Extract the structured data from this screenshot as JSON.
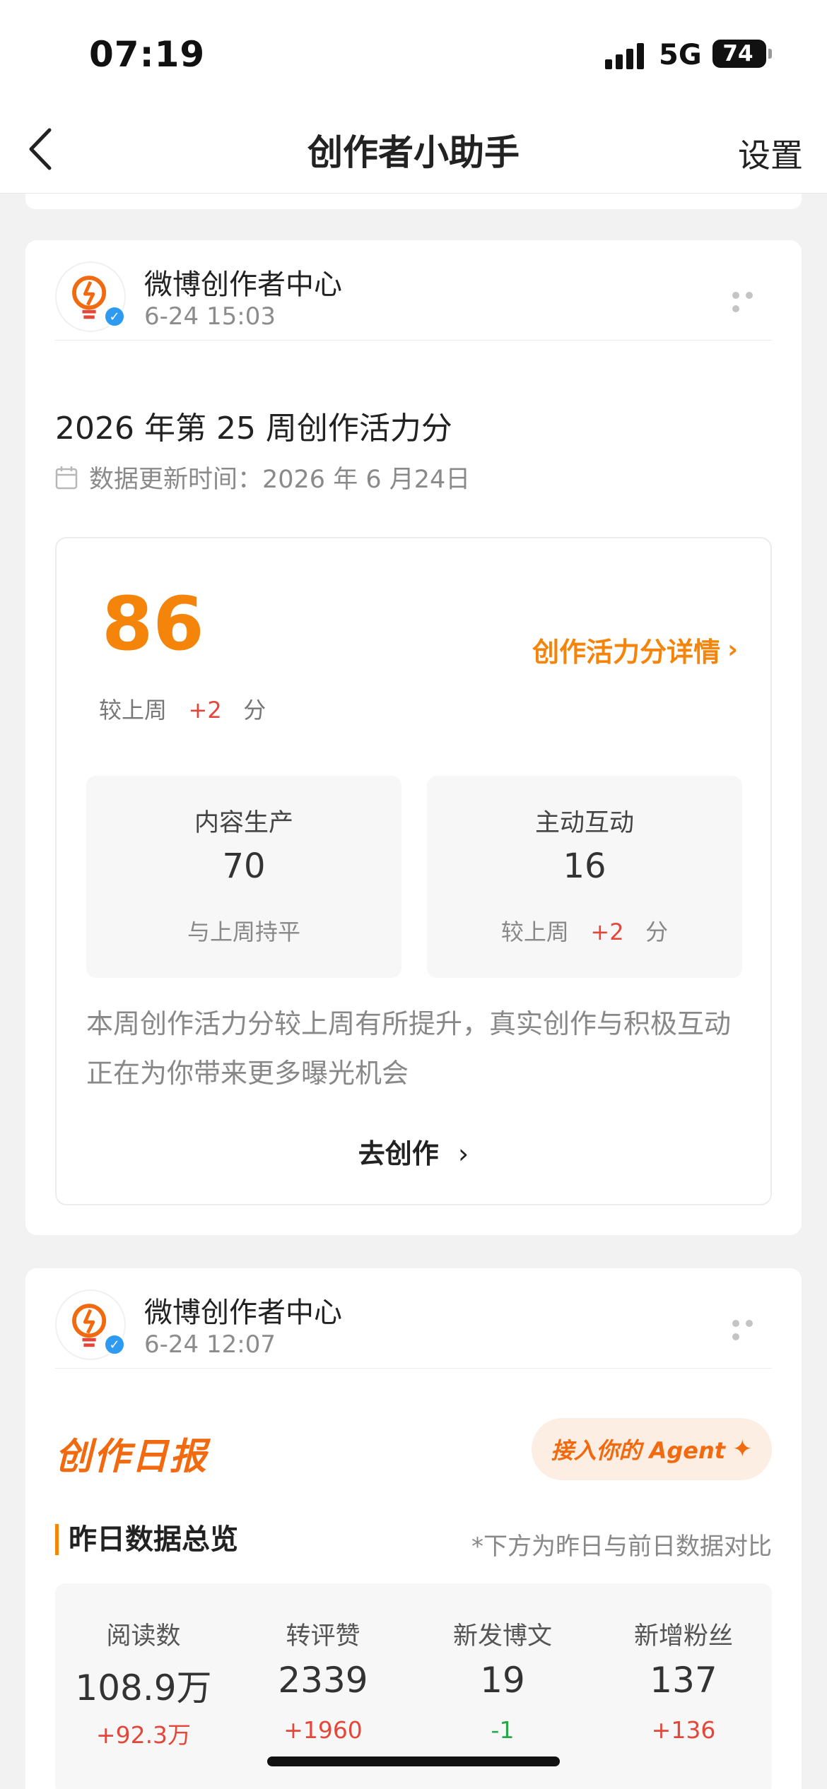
{
  "status": {
    "time": "07:19",
    "network": "5G",
    "battery": "74"
  },
  "nav": {
    "title": "创作者小助手",
    "settings": "设置"
  },
  "post1": {
    "author": "微博创作者中心",
    "time": "6-24 15:03",
    "title": "2026 年第 25 周创作活力分",
    "update_time": "数据更新时间：2026 年 6 月24日",
    "score": "86",
    "detail_link": "创作活力分详情",
    "delta_prefix": "较上周",
    "delta_value": "+2",
    "delta_unit": "分",
    "content": {
      "label": "内容生产",
      "value": "70",
      "note": "与上周持平"
    },
    "interact": {
      "label": "主动互动",
      "value": "16",
      "note_prefix": "较上周",
      "note_value": "+2",
      "note_unit": "分"
    },
    "summary": "本周创作活力分较上周有所提升，真实创作与积极互动正在为你带来更多曝光机会",
    "go_create": "去创作"
  },
  "post2": {
    "author": "微博创作者中心",
    "time": "6-24 12:07",
    "daily_title": "创作日报",
    "agent_button": "接入你的 Agent",
    "overview_title": "昨日数据总览",
    "overview_note": "*下方为昨日与前日数据对比",
    "stats": [
      {
        "label": "阅读数",
        "value": "108.9万",
        "delta": "+92.3万"
      },
      {
        "label": "转评赞",
        "value": "2339",
        "delta": "+1960"
      },
      {
        "label": "新发博文",
        "value": "19",
        "delta": "-1"
      },
      {
        "label": "新增粉丝",
        "value": "137",
        "delta": "+136"
      }
    ]
  },
  "colors": {
    "accent": "#f5840b",
    "up": "#e4473a",
    "down": "#2aa74b",
    "verify": "#2e9bf0"
  }
}
